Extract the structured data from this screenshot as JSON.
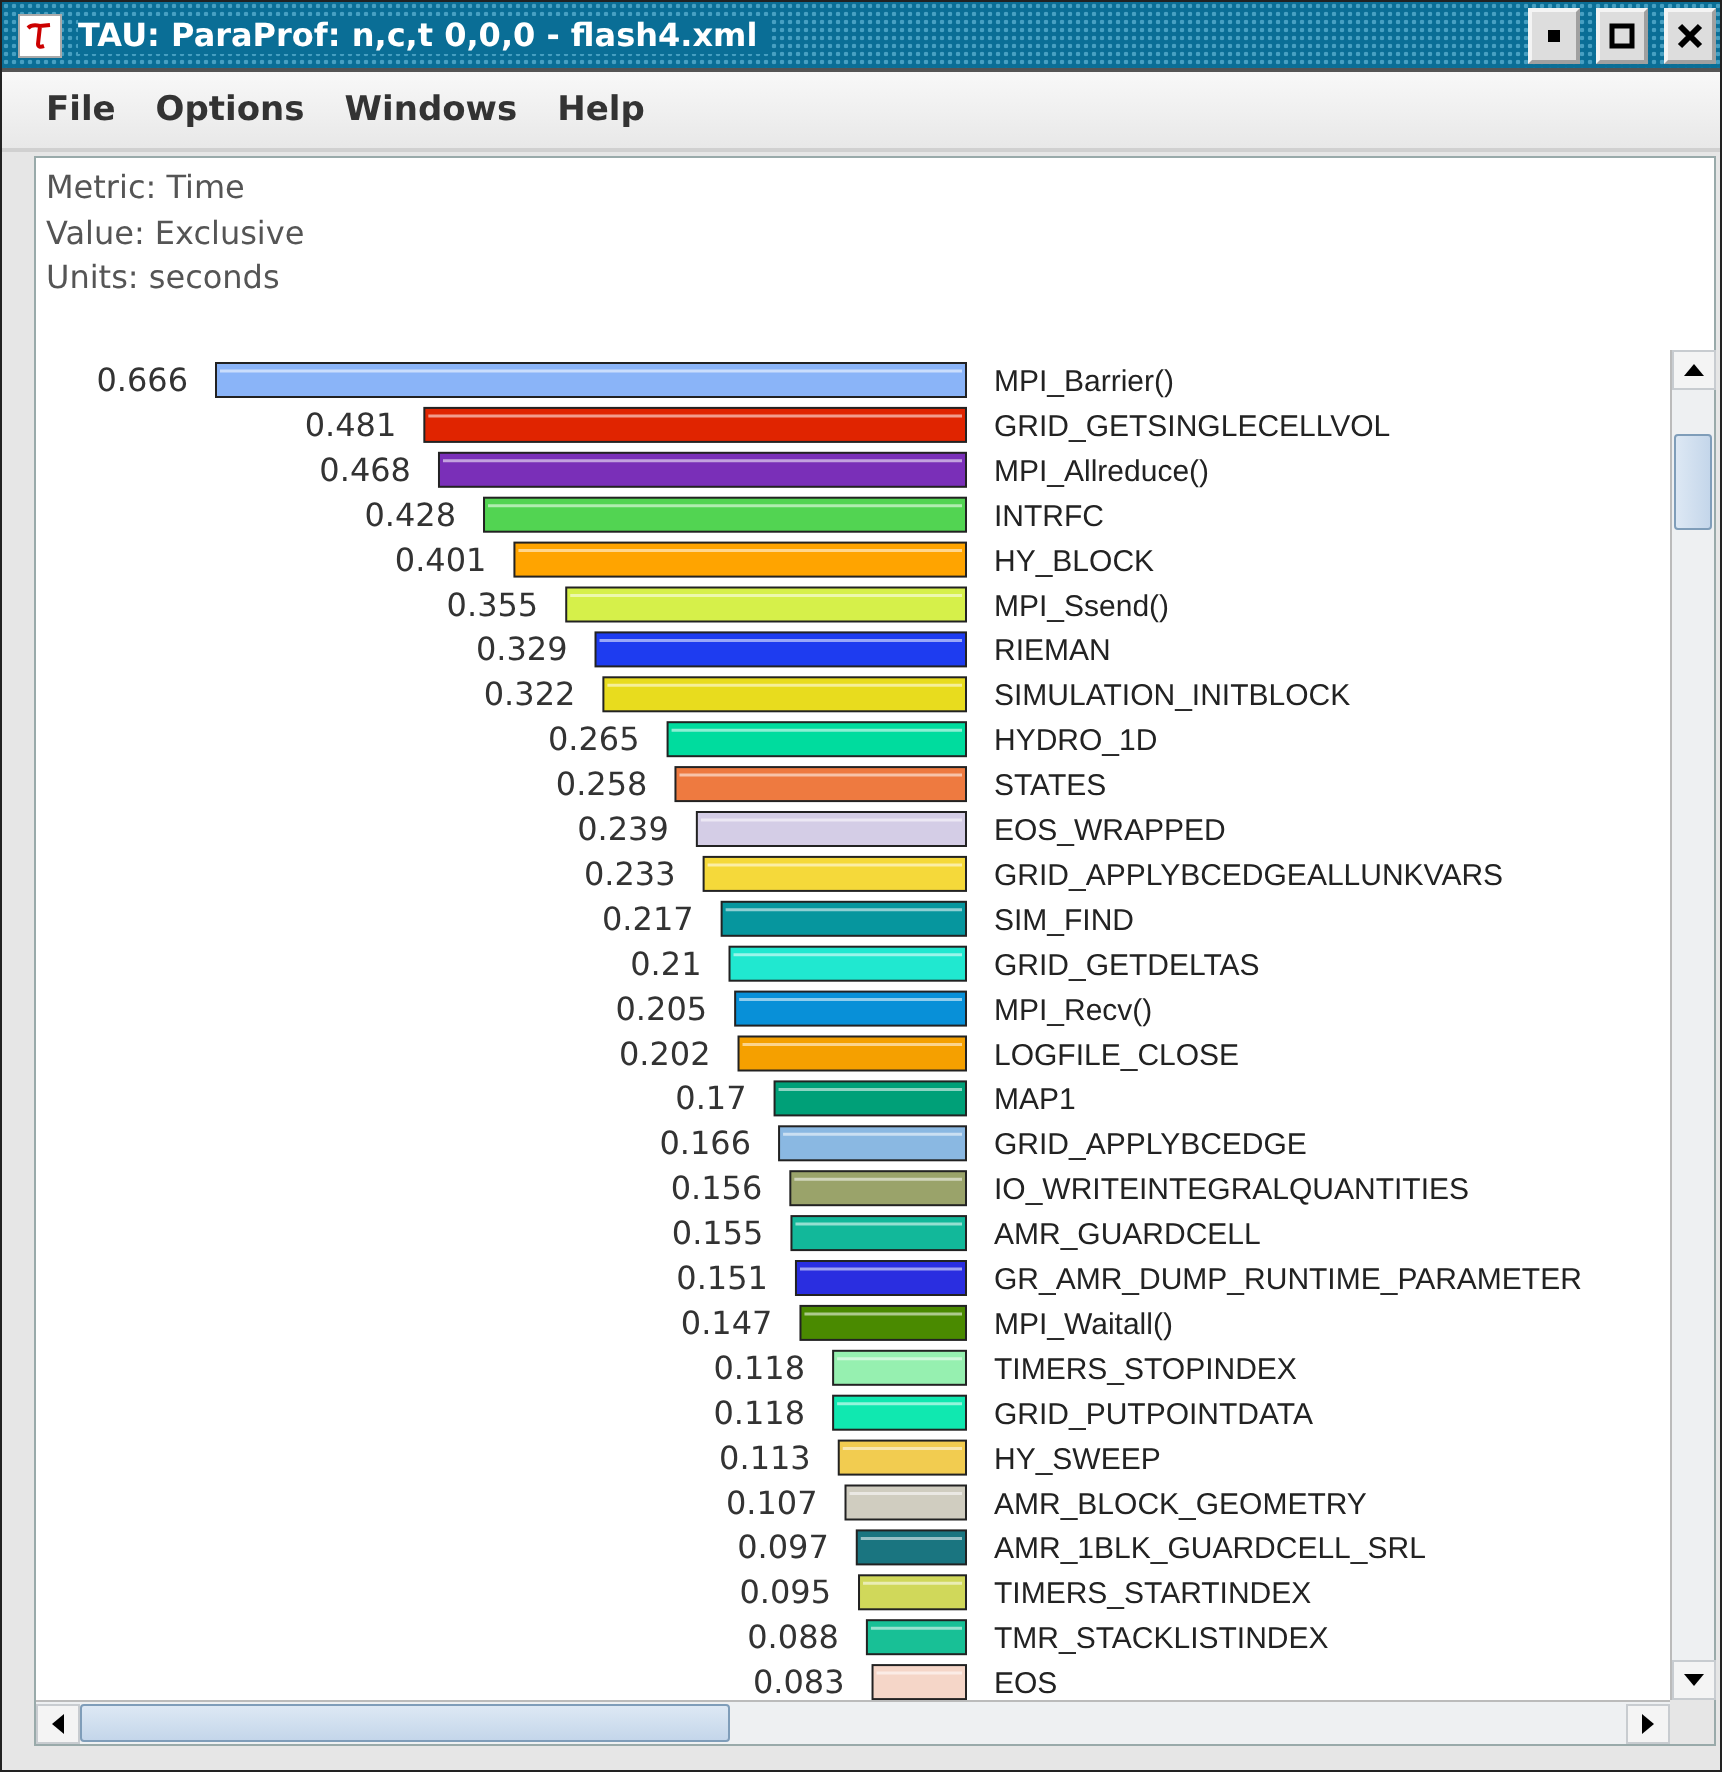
{
  "window": {
    "title": "TAU: ParaProf: n,c,t 0,0,0 - flash4.xml"
  },
  "menu": [
    "File",
    "Options",
    "Windows",
    "Help"
  ],
  "info": [
    "Metric: Time",
    "Value: Exclusive",
    "Units: seconds"
  ],
  "chart": {
    "chart_data": {
      "type": "bar",
      "orientation": "horizontal",
      "data_labels": true,
      "categories": [
        "MPI_Barrier()",
        "GRID_GETSINGLECELLVOL",
        "MPI_Allreduce()",
        "INTRFC",
        "HY_BLOCK",
        "MPI_Ssend()",
        "RIEMAN",
        "SIMULATION_INITBLOCK",
        "HYDRO_1D",
        "STATES",
        "EOS_WRAPPED",
        "GRID_APPLYBCEDGEALLUNKVARS",
        "SIM_FIND",
        "GRID_GETDELTAS",
        "MPI_Recv()",
        "LOGFILE_CLOSE",
        "MAP1",
        "GRID_APPLYBCEDGE",
        "IO_WRITEINTEGRALQUANTITIES",
        "AMR_GUARDCELL",
        "GR_AMR_DUMP_RUNTIME_PARAMETER",
        "MPI_Waitall()",
        "TIMERS_STOPINDEX",
        "GRID_PUTPOINTDATA",
        "HY_SWEEP",
        "AMR_BLOCK_GEOMETRY",
        "AMR_1BLK_GUARDCELL_SRL",
        "TIMERS_STARTINDEX",
        "TMR_STACKLISTINDEX",
        "EOS"
      ],
      "series": [
        {
          "values": [
            0.666,
            0.481,
            0.468,
            0.428,
            0.401,
            0.355,
            0.329,
            0.322,
            0.265,
            0.258,
            0.239,
            0.233,
            0.217,
            0.21,
            0.205,
            0.202,
            0.17,
            0.166,
            0.156,
            0.155,
            0.151,
            0.147,
            0.118,
            0.118,
            0.113,
            0.107,
            0.097,
            0.095,
            0.088,
            0.083
          ]
        }
      ],
      "colors": [
        "#8ab4f8",
        "#e02400",
        "#7a2fb8",
        "#52d452",
        "#ffa400",
        "#d6f04a",
        "#1e3cf0",
        "#e8dc1e",
        "#00dc9e",
        "#ee7a40",
        "#d4cde6",
        "#f5d93a",
        "#06969e",
        "#20e8d0",
        "#0890d8",
        "#f5a000",
        "#00a078",
        "#8ab8e2",
        "#9aa36a",
        "#12b89a",
        "#2a2ee0",
        "#4a8a00",
        "#96f0b0",
        "#10e8b0",
        "#f2cc50",
        "#d0cdc0",
        "#1a7580",
        "#d0d85a",
        "#18c096",
        "#f5d6c8"
      ]
    }
  }
}
